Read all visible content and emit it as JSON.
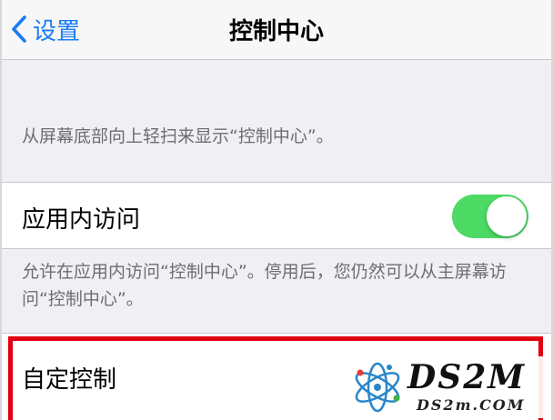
{
  "nav": {
    "back_label": "设置",
    "title": "控制中心"
  },
  "section1": {
    "footer": "从屏幕底部向上轻扫来显示“控制中心”。"
  },
  "in_app_access": {
    "label": "应用内访问",
    "toggle_on": true,
    "toggle_color": "#4cd964"
  },
  "section2": {
    "footer": "允许在应用内访问“控制中心”。停用后，您仍然可以从主屏幕访问“控制中心”。"
  },
  "customize": {
    "label": "自定控制"
  },
  "colors": {
    "accent": "#1a7cf5",
    "highlight": "#e00012",
    "background": "#efeff4"
  },
  "watermark": {
    "title": "DS2M",
    "subtitle": "DS2m.COM"
  }
}
